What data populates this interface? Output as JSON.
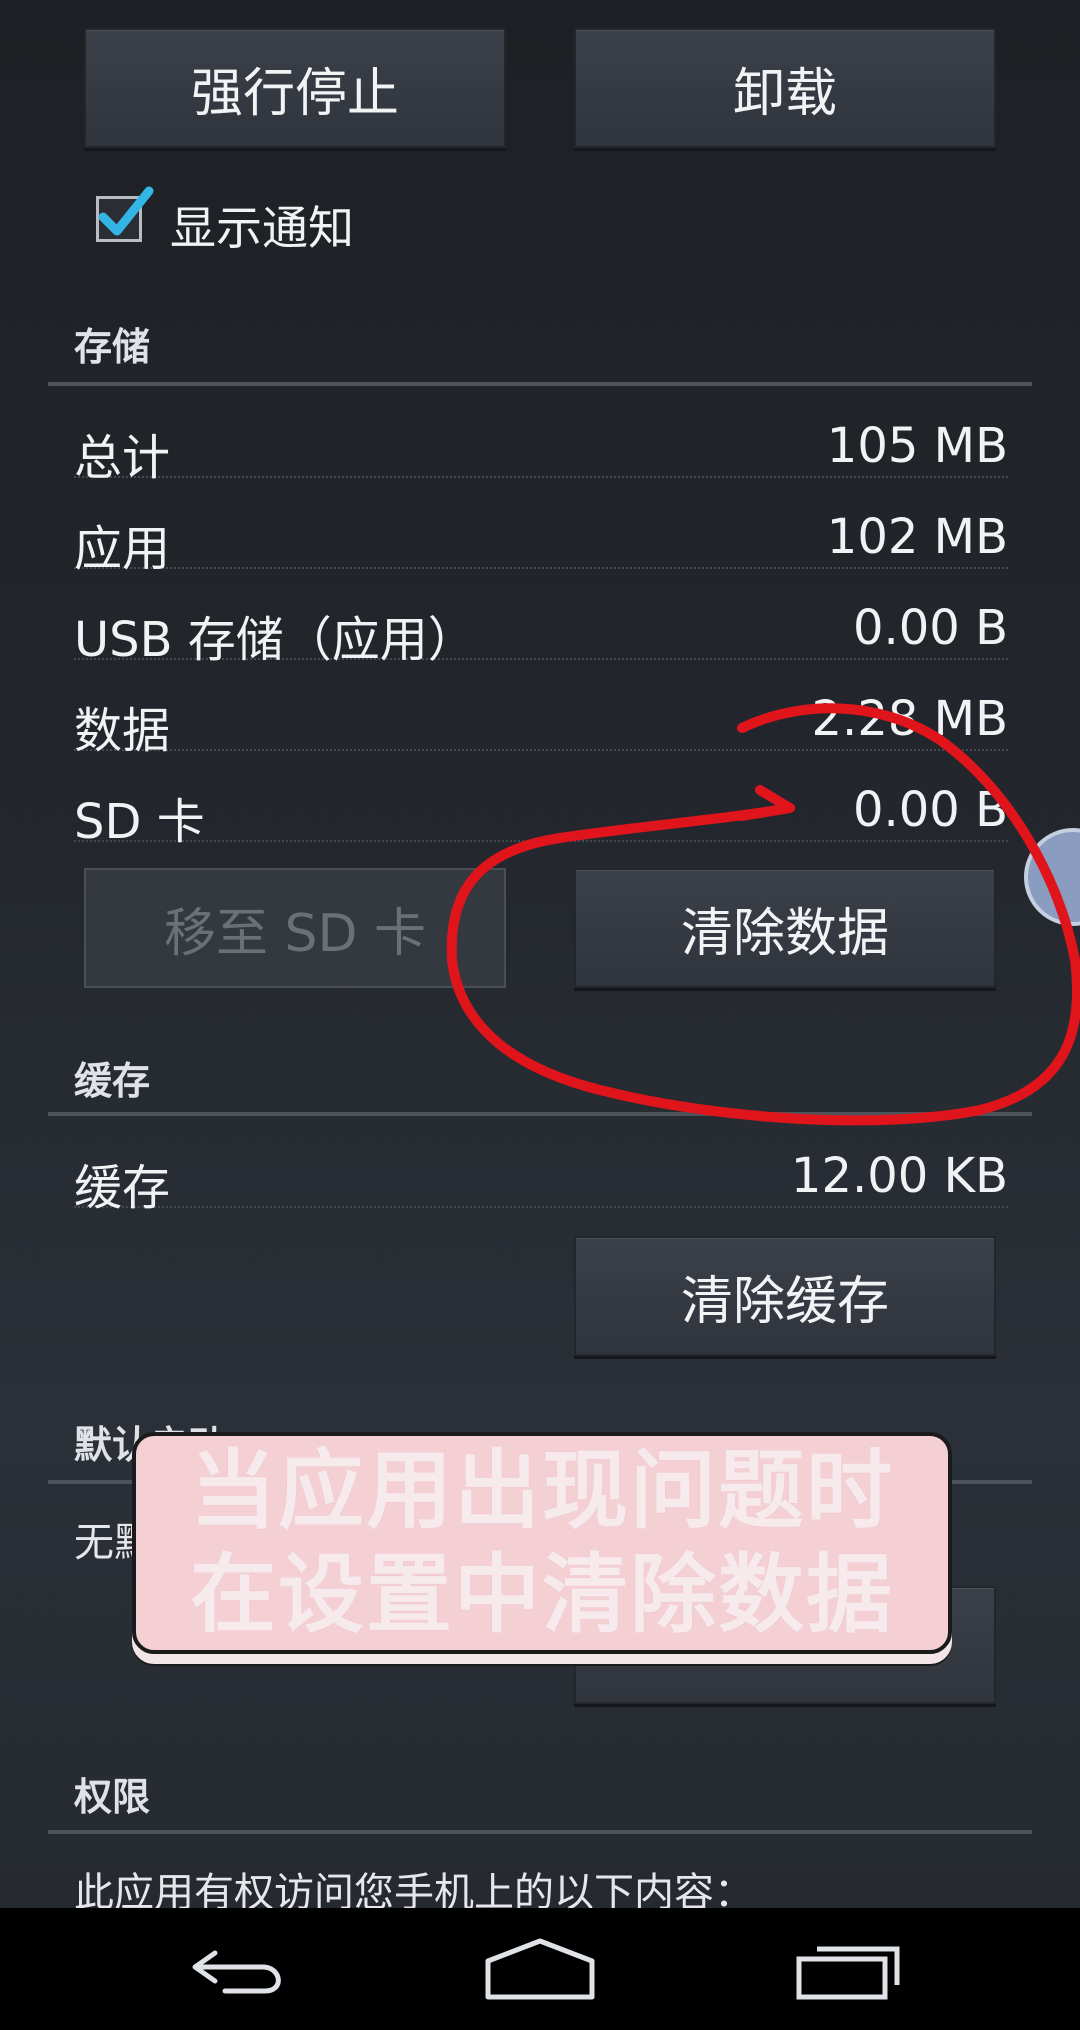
{
  "top_buttons": {
    "force_stop": "强行停止",
    "uninstall": "卸载"
  },
  "show_notifications": {
    "label": "显示通知",
    "checked": true
  },
  "storage": {
    "header": "存储",
    "rows": [
      {
        "label": "总计",
        "value": "105 MB"
      },
      {
        "label": "应用",
        "value": "102 MB"
      },
      {
        "label": "USB 存储（应用）",
        "value": "0.00 B"
      },
      {
        "label": "数据",
        "value": "2.28 MB"
      },
      {
        "label": "SD 卡",
        "value": "0.00 B"
      }
    ],
    "move_to_sd": "移至 SD 卡",
    "clear_data": "清除数据"
  },
  "cache": {
    "header": "缓存",
    "row": {
      "label": "缓存",
      "value": "12.00 KB"
    },
    "clear_cache": "清除缓存"
  },
  "launch_default": {
    "header": "默认启动",
    "text": "无默认设置。"
  },
  "permissions": {
    "header": "权限",
    "text": "此应用有权访问您手机上的以下内容："
  },
  "caption": {
    "line1": "当应用出现问题时",
    "line2": "在设置中清除数据"
  },
  "colors": {
    "annotation": "#e0141b",
    "checkmark": "#33b5e5",
    "caption_bg": "#f4d0d5"
  },
  "nav": {
    "back": "back-icon",
    "home": "home-icon",
    "recents": "recents-icon"
  }
}
